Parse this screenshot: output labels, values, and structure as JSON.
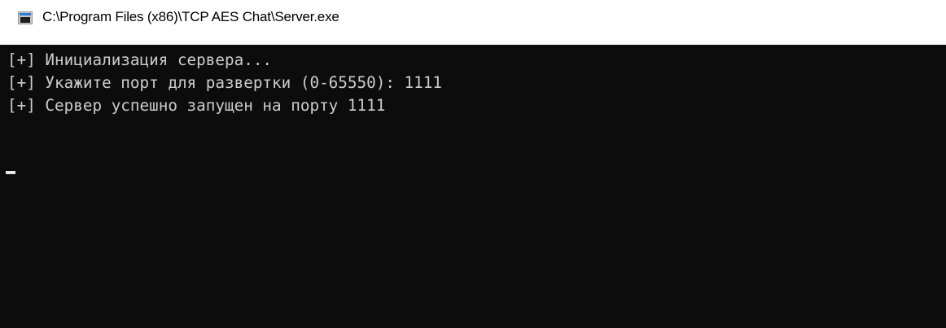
{
  "window": {
    "title": "C:\\Program Files (x86)\\TCP AES Chat\\Server.exe",
    "icon": "console-app-icon"
  },
  "console": {
    "lines": [
      "[+] Инициализация сервера...",
      "[+] Укажите порт для развертки (0-65550): 1111",
      "[+] Сервер успешно запущен на порту 1111"
    ],
    "background_color": "#0c0c0c",
    "text_color": "#cccccc"
  }
}
